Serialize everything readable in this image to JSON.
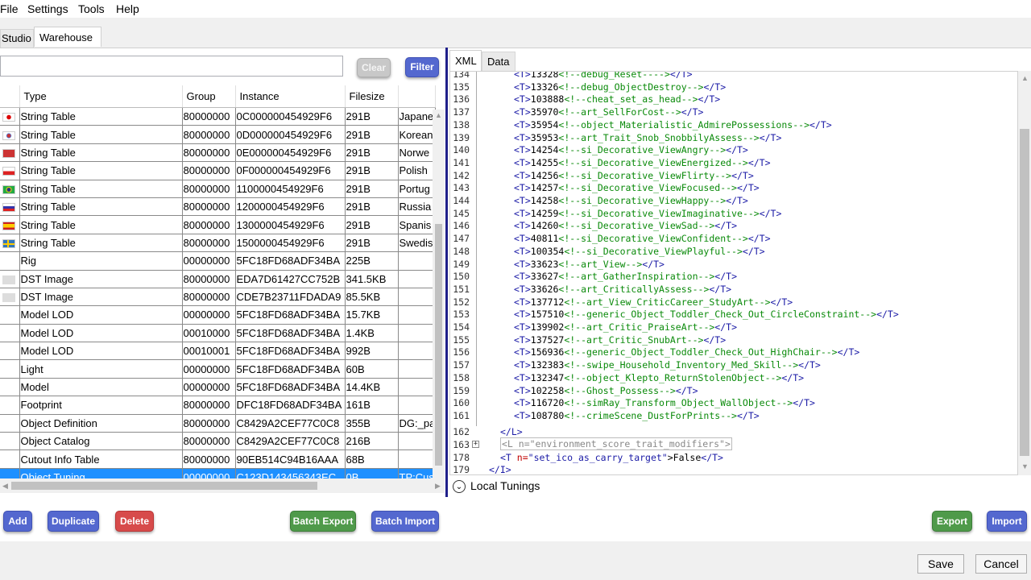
{
  "menu": [
    "File",
    "Settings",
    "Tools",
    "Help"
  ],
  "tabs": {
    "studio": "Studio",
    "warehouse": "Warehouse"
  },
  "search": {
    "value": "",
    "placeholder": ""
  },
  "buttons": {
    "clear": "Clear",
    "filter": "Filter",
    "add": "Add",
    "duplicate": "Duplicate",
    "delete": "Delete",
    "batch_export": "Batch Export",
    "batch_import": "Batch Import",
    "export": "Export",
    "import": "Import",
    "save": "Save",
    "cancel": "Cancel"
  },
  "colors": {
    "accent_blue": "#5468cf",
    "danger_red": "#d74b4b",
    "ok_green": "#4f9a4a",
    "selection": "#1e90ff"
  },
  "grid": {
    "columns": [
      "",
      "Type",
      "Group",
      "Instance",
      "Filesize",
      ""
    ],
    "rows": [
      {
        "icon": "japan-flag-icon",
        "type": "String Table",
        "group": "80000000",
        "instance": "0C000000454929F6",
        "filesize": "291B",
        "extra": "Japane"
      },
      {
        "icon": "korea-flag-icon",
        "type": "String Table",
        "group": "80000000",
        "instance": "0D000000454929F6",
        "filesize": "291B",
        "extra": "Korean"
      },
      {
        "icon": "norway-flag-icon",
        "type": "String Table",
        "group": "80000000",
        "instance": "0E000000454929F6",
        "filesize": "291B",
        "extra": "Norwe"
      },
      {
        "icon": "poland-flag-icon",
        "type": "String Table",
        "group": "80000000",
        "instance": "0F000000454929F6",
        "filesize": "291B",
        "extra": "Polish"
      },
      {
        "icon": "brazil-flag-icon",
        "type": "String Table",
        "group": "80000000",
        "instance": "1100000454929F6",
        "filesize": "291B",
        "extra": "Portug"
      },
      {
        "icon": "russia-flag-icon",
        "type": "String Table",
        "group": "80000000",
        "instance": "1200000454929F6",
        "filesize": "291B",
        "extra": "Russia"
      },
      {
        "icon": "spain-flag-icon",
        "type": "String Table",
        "group": "80000000",
        "instance": "1300000454929F6",
        "filesize": "291B",
        "extra": "Spanis"
      },
      {
        "icon": "sweden-flag-icon",
        "type": "String Table",
        "group": "80000000",
        "instance": "1500000454929F6",
        "filesize": "291B",
        "extra": "Swedis"
      },
      {
        "icon": "",
        "type": "Rig",
        "group": "00000000",
        "instance": "5FC18FD68ADF34BA",
        "filesize": "225B",
        "extra": ""
      },
      {
        "icon": "image-icon",
        "type": "DST Image",
        "group": "80000000",
        "instance": "EDA7D61427CC752B",
        "filesize": "341.5KB",
        "extra": ""
      },
      {
        "icon": "image-icon",
        "type": "DST Image",
        "group": "80000000",
        "instance": "CDE7B23711FDADA9",
        "filesize": "85.5KB",
        "extra": ""
      },
      {
        "icon": "",
        "type": "Model LOD",
        "group": "00000000",
        "instance": "5FC18FD68ADF34BA",
        "filesize": "15.7KB",
        "extra": ""
      },
      {
        "icon": "",
        "type": "Model LOD",
        "group": "00010000",
        "instance": "5FC18FD68ADF34BA",
        "filesize": "1.4KB",
        "extra": ""
      },
      {
        "icon": "",
        "type": "Model LOD",
        "group": "00010001",
        "instance": "5FC18FD68ADF34BA",
        "filesize": "992B",
        "extra": ""
      },
      {
        "icon": "",
        "type": "Light",
        "group": "00000000",
        "instance": "5FC18FD68ADF34BA",
        "filesize": "60B",
        "extra": ""
      },
      {
        "icon": "",
        "type": "Model",
        "group": "00000000",
        "instance": "5FC18FD68ADF34BA",
        "filesize": "14.4KB",
        "extra": ""
      },
      {
        "icon": "",
        "type": "Footprint",
        "group": "80000000",
        "instance": "DFC18FD68ADF34BA",
        "filesize": "161B",
        "extra": ""
      },
      {
        "icon": "",
        "type": "Object Definition",
        "group": "80000000",
        "instance": "C8429A2CEF77C0C8",
        "filesize": "355B",
        "extra": "DG:_pa"
      },
      {
        "icon": "",
        "type": "Object Catalog",
        "group": "80000000",
        "instance": "C8429A2CEF77C0C8",
        "filesize": "216B",
        "extra": ""
      },
      {
        "icon": "",
        "type": "Cutout Info Table",
        "group": "80000000",
        "instance": "90EB514C94B16AAA",
        "filesize": "68B",
        "extra": ""
      },
      {
        "icon": "",
        "type": "Object Tuning",
        "group": "00000000",
        "instance": "C123D143456343EC",
        "filesize": "0B",
        "extra": "TP:Cus",
        "selected": true
      }
    ]
  },
  "editor_tabs": {
    "xml": "XML",
    "data": "Data"
  },
  "xml_lines": [
    {
      "n": "134",
      "id": "13328",
      "c": "debug_Reset--"
    },
    {
      "n": "135",
      "id": "13326",
      "c": "debug_ObjectDestroy"
    },
    {
      "n": "136",
      "id": "103888",
      "c": "cheat_set_as_head"
    },
    {
      "n": "137",
      "id": "35970",
      "c": "art_SellForCost"
    },
    {
      "n": "138",
      "id": "35954",
      "c": "object_Materialistic_AdmirePossessions"
    },
    {
      "n": "139",
      "id": "35953",
      "c": "art_Trait_Snob_SnobbilyAssess"
    },
    {
      "n": "140",
      "id": "14254",
      "c": "si_Decorative_ViewAngry"
    },
    {
      "n": "141",
      "id": "14255",
      "c": "si_Decorative_ViewEnergized"
    },
    {
      "n": "142",
      "id": "14256",
      "c": "si_Decorative_ViewFlirty"
    },
    {
      "n": "143",
      "id": "14257",
      "c": "si_Decorative_ViewFocused"
    },
    {
      "n": "144",
      "id": "14258",
      "c": "si_Decorative_ViewHappy"
    },
    {
      "n": "145",
      "id": "14259",
      "c": "si_Decorative_ViewImaginative"
    },
    {
      "n": "146",
      "id": "14260",
      "c": "si_Decorative_ViewSad"
    },
    {
      "n": "147",
      "id": "40811",
      "c": "si_Decorative_ViewConfident"
    },
    {
      "n": "148",
      "id": "100354",
      "c": "si_Decorative_ViewPlayful"
    },
    {
      "n": "149",
      "id": "33623",
      "c": "art_View"
    },
    {
      "n": "150",
      "id": "33627",
      "c": "art_GatherInspiration"
    },
    {
      "n": "151",
      "id": "33626",
      "c": "art_CriticallyAssess"
    },
    {
      "n": "152",
      "id": "137712",
      "c": "art_View_CriticCareer_StudyArt"
    },
    {
      "n": "153",
      "id": "157510",
      "c": "generic_Object_Toddler_Check_Out_CircleConstraint"
    },
    {
      "n": "154",
      "id": "139902",
      "c": "art_Critic_PraiseArt"
    },
    {
      "n": "155",
      "id": "137527",
      "c": "art_Critic_SnubArt"
    },
    {
      "n": "156",
      "id": "156936",
      "c": "generic_Object_Toddler_Check_Out_HighChair"
    },
    {
      "n": "157",
      "id": "132383",
      "c": "swipe_Household_Inventory_Med_Skill"
    },
    {
      "n": "158",
      "id": "132347",
      "c": "object_Klepto_ReturnStolenObject"
    },
    {
      "n": "159",
      "id": "102258",
      "c": "Ghost_Possess"
    },
    {
      "n": "160",
      "id": "116720",
      "c": "simRay_Transform_Object_WallObject"
    },
    {
      "n": "161",
      "id": "108780",
      "c": "crimeScene_DustForPrints"
    }
  ],
  "xml_tail": {
    "l162": "162",
    "l163": "163",
    "l178": "178",
    "l179": "179",
    "close_l": "</L>",
    "collapsed_text": "<L n=\"environment_score_trait_modifiers\">",
    "t_open": "<T ",
    "t_attr": "n=",
    "t_val": "\"set_ico_as_carry_target\"",
    "t_text": ">False",
    "t_close": "</T>",
    "close_i": "</I>"
  },
  "local_tunings": "Local Tunings"
}
